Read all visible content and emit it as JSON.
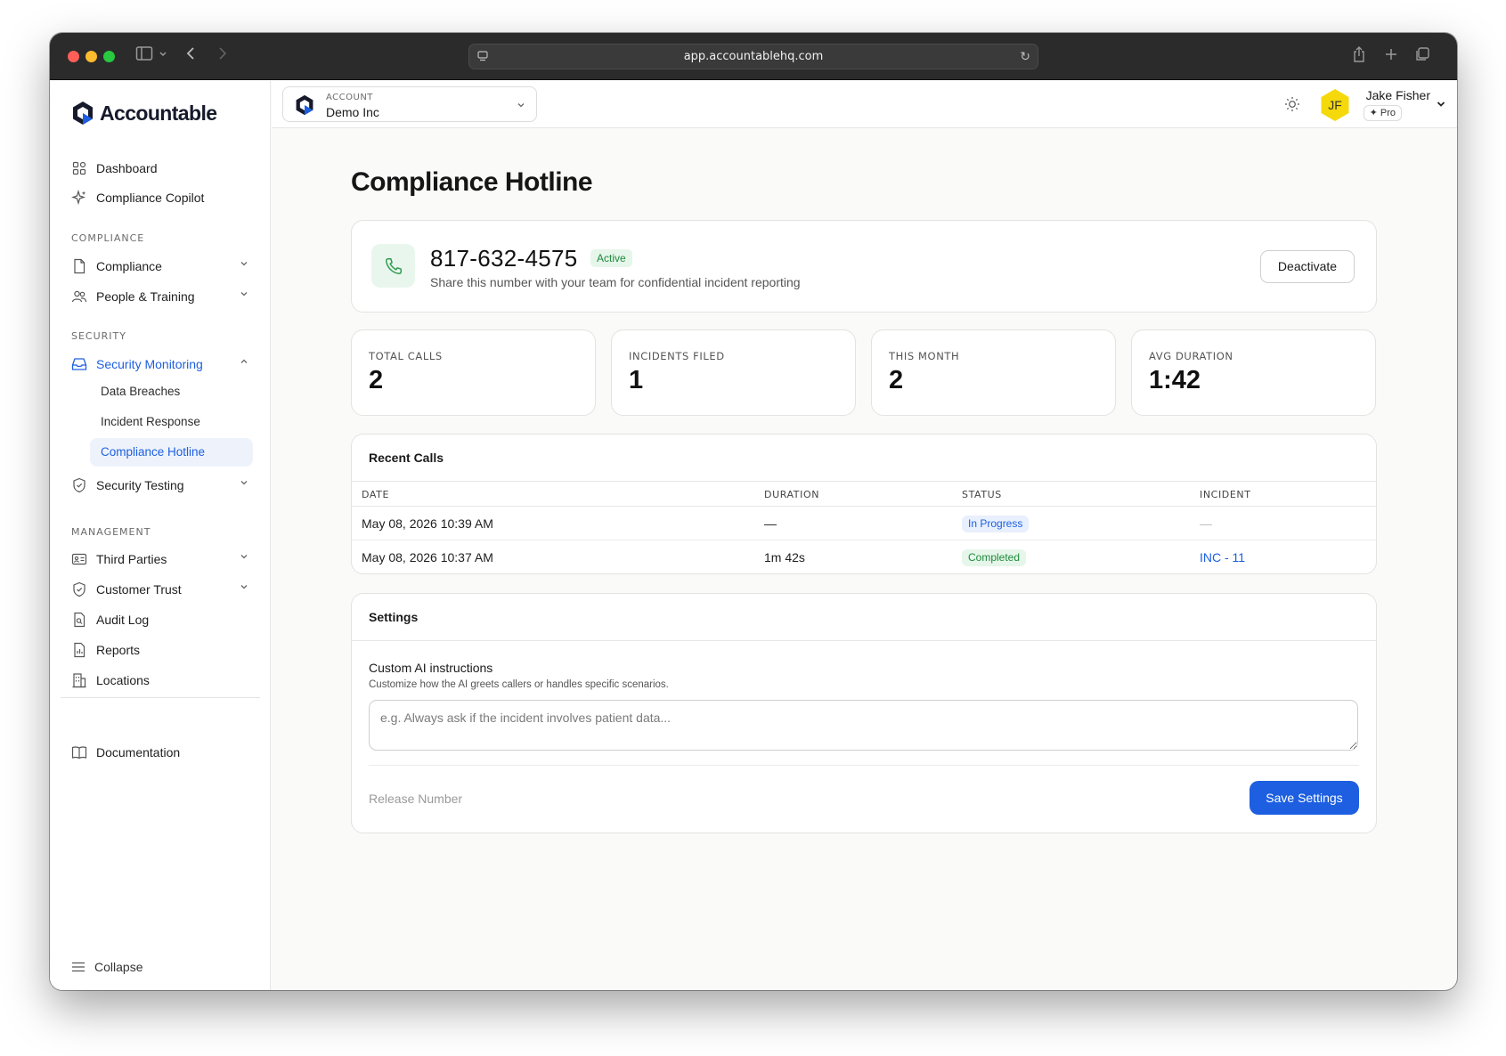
{
  "browser": {
    "url": "app.accountablehq.com"
  },
  "sidebar": {
    "logo_text": "Accountable",
    "top_items": [
      {
        "label": "Dashboard",
        "icon": "grid-icon"
      },
      {
        "label": "Compliance Copilot",
        "icon": "sparkle-icon"
      }
    ],
    "sections": [
      {
        "label": "COMPLIANCE"
      },
      {
        "label": "SECURITY"
      },
      {
        "label": "MANAGEMENT"
      }
    ],
    "compliance_items": [
      {
        "label": "Compliance",
        "icon": "document-icon"
      },
      {
        "label": "People & Training",
        "icon": "people-icon"
      }
    ],
    "security_items": [
      {
        "label": "Security Monitoring",
        "icon": "inbox-icon"
      },
      {
        "label": "Security Testing",
        "icon": "shield-check-icon"
      }
    ],
    "security_sub_items": [
      {
        "label": "Data Breaches"
      },
      {
        "label": "Incident Response"
      },
      {
        "label": "Compliance Hotline"
      }
    ],
    "management_items": [
      {
        "label": "Third Parties",
        "icon": "id-card-icon"
      },
      {
        "label": "Customer Trust",
        "icon": "shield-check-icon"
      },
      {
        "label": "Audit Log",
        "icon": "audit-doc-icon"
      },
      {
        "label": "Reports",
        "icon": "report-icon"
      },
      {
        "label": "Locations",
        "icon": "building-icon"
      }
    ],
    "documentation": "Documentation",
    "collapse": "Collapse"
  },
  "header": {
    "account_label": "ACCOUNT",
    "account_name": "Demo Inc",
    "avatar_initials": "JF",
    "user_name": "Jake Fisher",
    "plan": "Pro"
  },
  "page": {
    "title": "Compliance Hotline",
    "phone": {
      "number": "817-632-4575",
      "status": "Active",
      "description": "Share this number with your team for confidential incident reporting",
      "deactivate_label": "Deactivate"
    },
    "stats": [
      {
        "label": "TOTAL CALLS",
        "value": "2"
      },
      {
        "label": "INCIDENTS FILED",
        "value": "1"
      },
      {
        "label": "THIS MONTH",
        "value": "2"
      },
      {
        "label": "AVG DURATION",
        "value": "1:42"
      }
    ],
    "recent_calls": {
      "title": "Recent Calls",
      "columns": [
        "DATE",
        "DURATION",
        "STATUS",
        "INCIDENT"
      ],
      "rows": [
        {
          "date": "May 08, 2026 10:39 AM",
          "duration": "—",
          "status": "In Progress",
          "incident": "—"
        },
        {
          "date": "May 08, 2026 10:37 AM",
          "duration": "1m 42s",
          "status": "Completed",
          "incident": "INC - 11"
        }
      ]
    },
    "settings": {
      "title": "Settings",
      "field_label": "Custom AI instructions",
      "field_help": "Customize how the AI greets callers or handles specific scenarios.",
      "placeholder": "e.g. Always ask if the incident involves patient data...",
      "value": "",
      "release_label": "Release Number",
      "save_label": "Save Settings"
    }
  },
  "colors": {
    "accent": "#1d5fe0",
    "success": "#1e8a3c",
    "avatar": "#f5d90a"
  }
}
